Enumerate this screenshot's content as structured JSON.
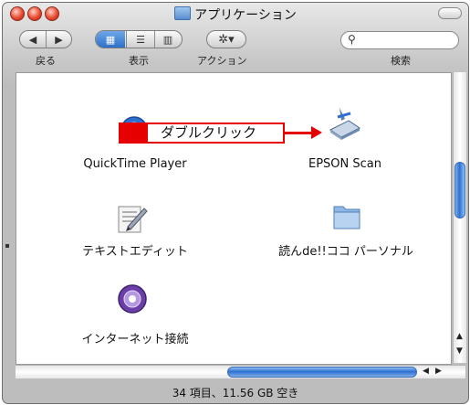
{
  "window": {
    "title": "アプリケーション"
  },
  "toolbar": {
    "back_label": "戻る",
    "view_label": "表示",
    "action_label": "アクション",
    "search_label": "検索"
  },
  "items": [
    {
      "name": "QuickTime Player",
      "icon": "quicktime-icon"
    },
    {
      "name": "EPSON Scan",
      "icon": "epson-scan-icon"
    },
    {
      "name": "テキストエディット",
      "icon": "textedit-icon"
    },
    {
      "name": "読んde!!ココ パーソナル",
      "icon": "folder-icon"
    },
    {
      "name": "インターネット接続",
      "icon": "internet-connect-icon"
    }
  ],
  "callout": {
    "text": "ダブルクリック"
  },
  "status": {
    "text": "34 項目、11.56 GB 空き"
  },
  "colors": {
    "accent": "#2e6fc7",
    "callout_red": "#e60000"
  }
}
